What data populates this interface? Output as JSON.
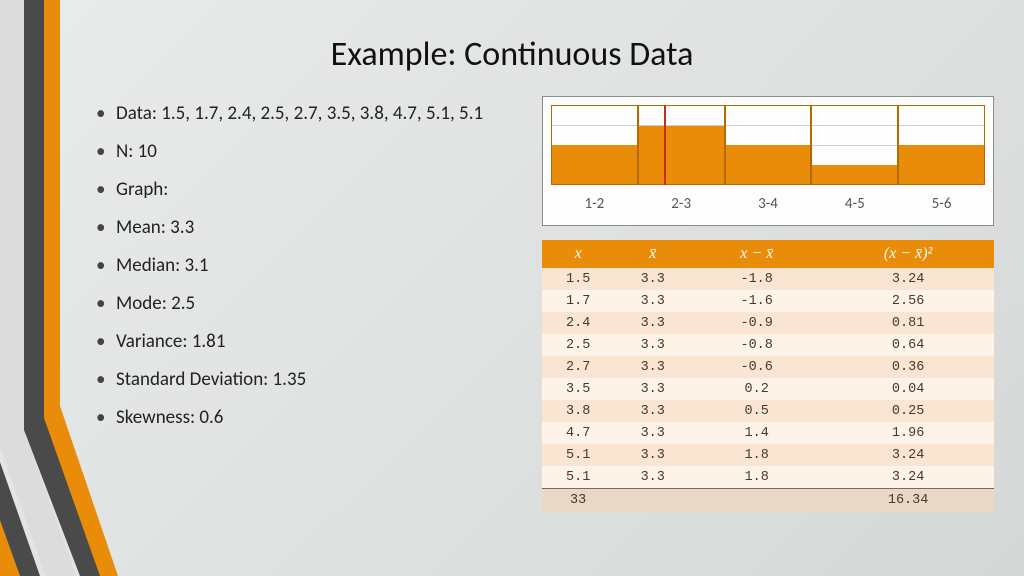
{
  "title": "Example: Continuous Data",
  "bullets": [
    "Data: 1.5, 1.7, 2.4, 2.5, 2.7, 3.5, 3.8, 4.7, 5.1, 5.1",
    "N: 10",
    "Graph:",
    "Mean: 3.3",
    "Median: 3.1",
    "Mode: 2.5",
    "Variance: 1.81",
    "Standard Deviation: 1.35",
    "Skewness: 0.6"
  ],
  "chart_data": {
    "type": "bar",
    "categories": [
      "1-2",
      "2-3",
      "3-4",
      "4-5",
      "5-6"
    ],
    "values": [
      2,
      3,
      2,
      1,
      2
    ],
    "ylim": [
      0,
      4
    ],
    "mean_marker_x": 2.3,
    "title": "",
    "xlabel": "",
    "ylabel": ""
  },
  "table": {
    "headers": [
      "x",
      "x̄",
      "x − x̄",
      "(x − x̄)²"
    ],
    "rows": [
      [
        "1.5",
        "3.3",
        "-1.8",
        "3.24"
      ],
      [
        "1.7",
        "3.3",
        "-1.6",
        "2.56"
      ],
      [
        "2.4",
        "3.3",
        "-0.9",
        "0.81"
      ],
      [
        "2.5",
        "3.3",
        "-0.8",
        "0.64"
      ],
      [
        "2.7",
        "3.3",
        "-0.6",
        "0.36"
      ],
      [
        "3.5",
        "3.3",
        "0.2",
        "0.04"
      ],
      [
        "3.8",
        "3.3",
        "0.5",
        "0.25"
      ],
      [
        "4.7",
        "3.3",
        "1.4",
        "1.96"
      ],
      [
        "5.1",
        "3.3",
        "1.8",
        "3.24"
      ],
      [
        "5.1",
        "3.3",
        "1.8",
        "3.24"
      ]
    ],
    "footer": [
      "33",
      "",
      "",
      "16.34"
    ]
  },
  "accent_color": "#e88c0a"
}
